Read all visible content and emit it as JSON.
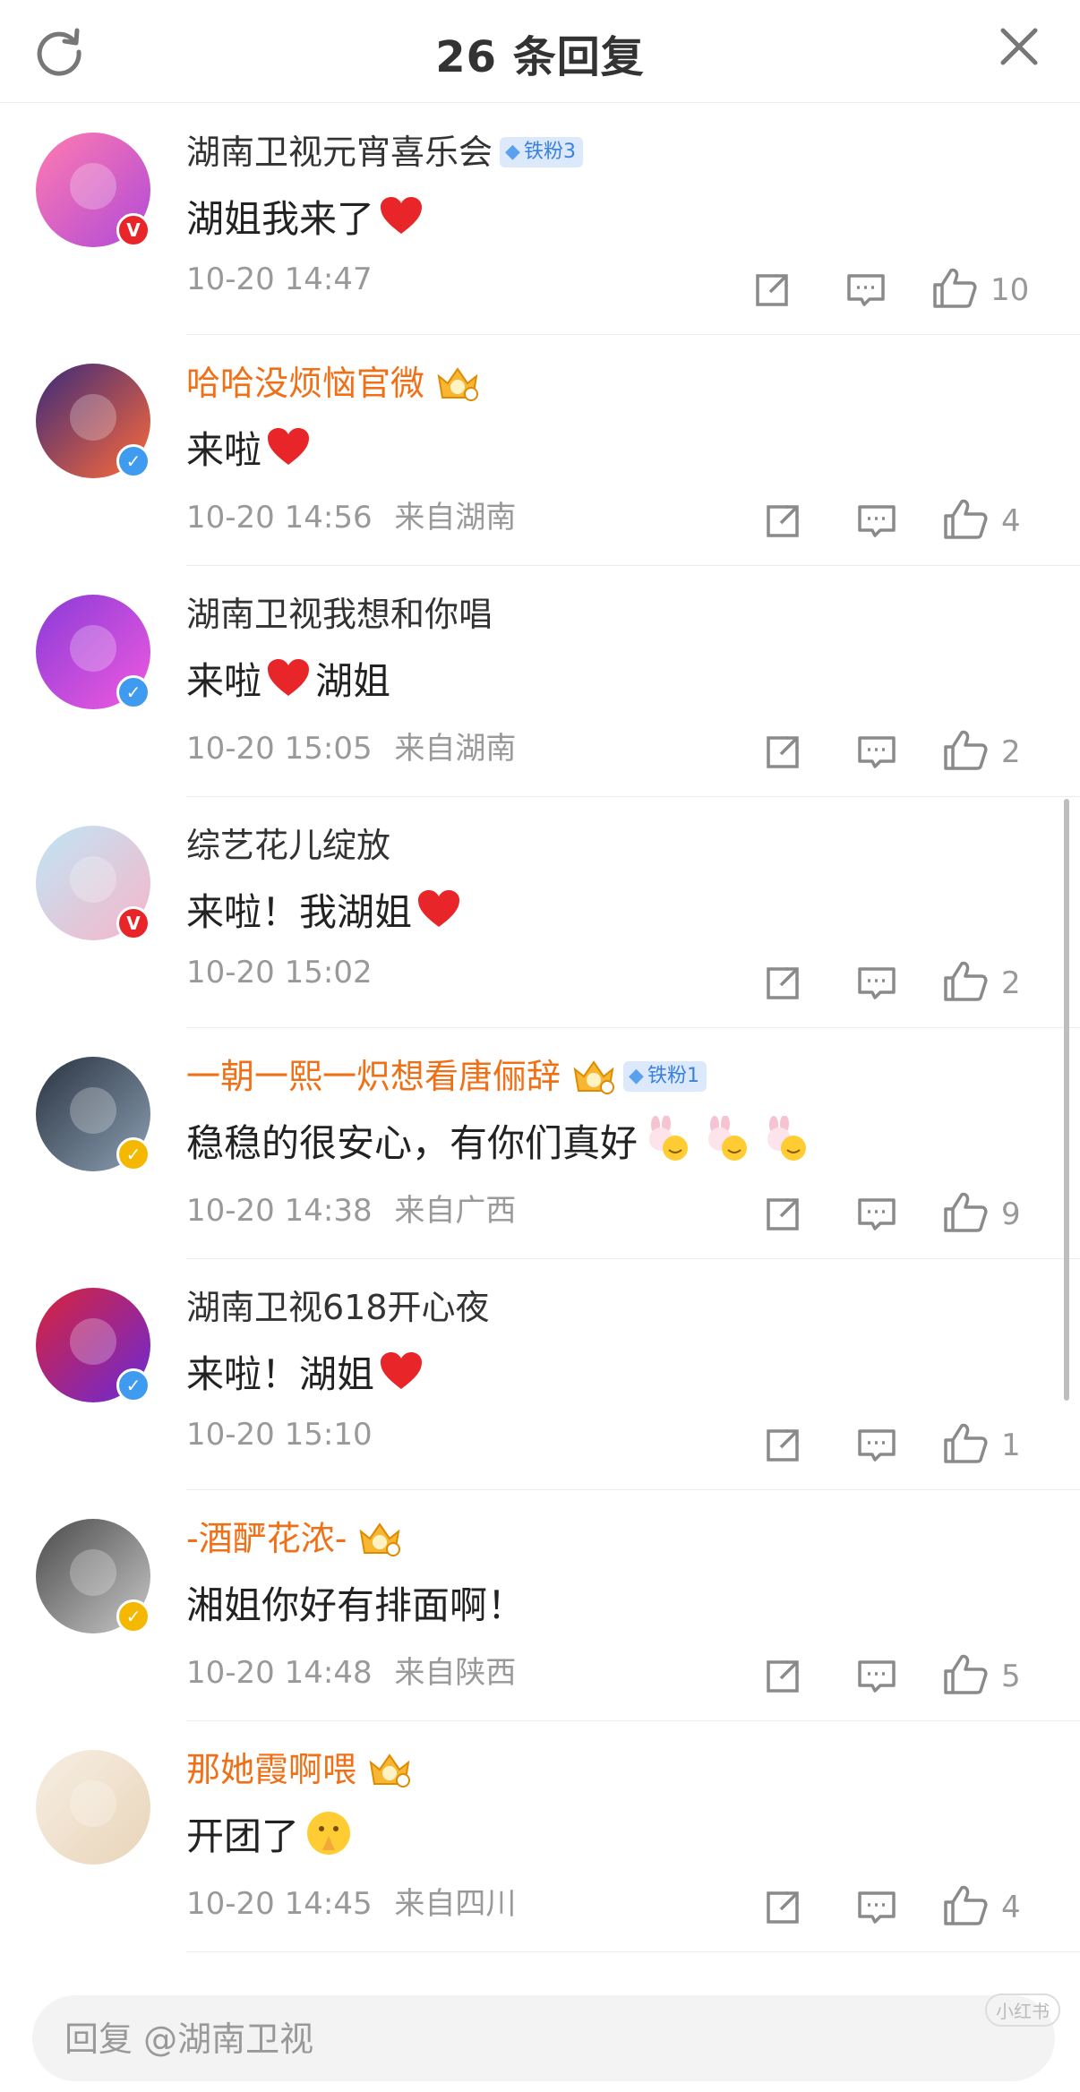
{
  "header": {
    "title": "26 条回复"
  },
  "comments": [
    {
      "name": "湖南卫视元宵喜乐会",
      "name_color": "gray",
      "crown": false,
      "fan_badge": "铁粉3",
      "verify": "red",
      "text": "湖姐我来了",
      "emoji": "heart",
      "emoji_after": "",
      "time": "10-20 14:47",
      "location": "",
      "likes": "10",
      "avatar_colors": [
        "#ff7bb0",
        "#b14ad8"
      ]
    },
    {
      "name": "哈哈没烦恼官微",
      "name_color": "orange",
      "crown": true,
      "fan_badge": "",
      "verify": "blue",
      "text": "来啦",
      "emoji": "heart",
      "emoji_after": "",
      "time": "10-20 14:56",
      "location": "来自湖南",
      "likes": "4",
      "avatar_colors": [
        "#3a2a7a",
        "#ff6a3a"
      ]
    },
    {
      "name": "湖南卫视我想和你唱",
      "name_color": "gray",
      "crown": false,
      "fan_badge": "",
      "verify": "blue",
      "text": "来啦",
      "emoji": "heart",
      "emoji_after": "湖姐",
      "time": "10-20 15:05",
      "location": "来自湖南",
      "likes": "2",
      "avatar_colors": [
        "#8a3bd8",
        "#f05adf"
      ]
    },
    {
      "name": "综艺花儿绽放",
      "name_color": "gray",
      "crown": false,
      "fan_badge": "",
      "verify": "red",
      "text": "来啦！我湖姐",
      "emoji": "heart",
      "emoji_after": "",
      "time": "10-20 15:02",
      "location": "",
      "likes": "2",
      "avatar_colors": [
        "#bfe6f5",
        "#f7b5c9"
      ]
    },
    {
      "name": "一朝一熙一炽想看唐俪辞",
      "name_color": "orange",
      "crown": true,
      "fan_badge": "铁粉1",
      "verify": "gold",
      "text": "稳稳的很安心，有你们真好",
      "emoji": "bunny",
      "emoji_after": "",
      "time": "10-20 14:38",
      "location": "来自广西",
      "likes": "9",
      "avatar_colors": [
        "#2a3340",
        "#8ca0b4"
      ]
    },
    {
      "name": "湖南卫视618开心夜",
      "name_color": "gray",
      "crown": false,
      "fan_badge": "",
      "verify": "blue",
      "text": "来啦！湖姐",
      "emoji": "heart",
      "emoji_after": "",
      "time": "10-20 15:10",
      "location": "",
      "likes": "1",
      "avatar_colors": [
        "#d8233a",
        "#6a2ad8"
      ]
    },
    {
      "name": "-酒酽花浓-",
      "name_color": "orange",
      "crown": true,
      "fan_badge": "",
      "verify": "gold",
      "text": "湘姐你好有排面啊！",
      "emoji": "",
      "emoji_after": "",
      "time": "10-20 14:48",
      "location": "来自陕西",
      "likes": "5",
      "avatar_colors": [
        "#4a4a4a",
        "#c9c9c9"
      ]
    },
    {
      "name": "那她霞啊喂",
      "name_color": "orange",
      "crown": true,
      "fan_badge": "",
      "verify": "",
      "text": "开团了",
      "emoji": "pray",
      "emoji_after": "",
      "time": "10-20 14:45",
      "location": "来自四川",
      "likes": "4",
      "avatar_colors": [
        "#f7efe4",
        "#e8d4b8"
      ]
    }
  ],
  "reply": {
    "placeholder": "回复 @湖南卫视"
  },
  "watermark": "小红书",
  "colors": {
    "accent_orange": "#f07017",
    "heart": "#e8262a",
    "verified_blue": "#3e9bef",
    "verified_red": "#e8262a",
    "verified_gold": "#f5b800"
  }
}
